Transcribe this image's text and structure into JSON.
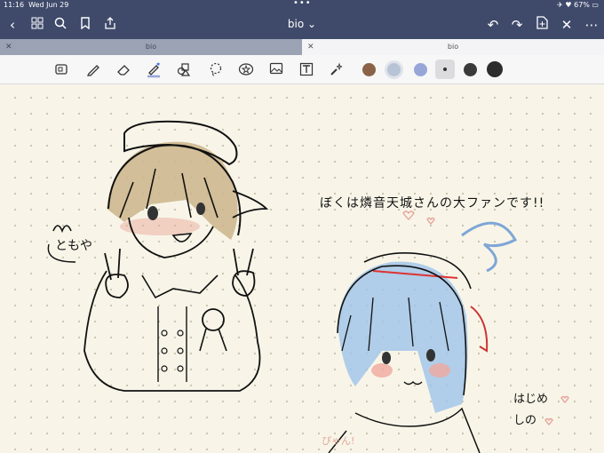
{
  "status": {
    "time": "11:16",
    "date": "Wed Jun 29",
    "battery": "67%"
  },
  "document": {
    "title": "bio",
    "dropdown_glyph": "⌄"
  },
  "tabs": [
    {
      "label": "bio",
      "active": false
    },
    {
      "label": "bio",
      "active": true
    }
  ],
  "nav_icons_left": [
    "back-icon",
    "grid-icon",
    "search-icon",
    "bookmark-icon",
    "share-icon"
  ],
  "nav_icons_right": [
    "undo-icon",
    "redo-icon",
    "add-page-icon",
    "close-icon",
    "more-icon"
  ],
  "tools": [
    "lasso-select-icon",
    "pen-icon",
    "eraser-icon",
    "highlighter-icon",
    "shapes-icon",
    "lasso-icon",
    "sticker-icon",
    "image-icon",
    "text-icon",
    "laser-pointer-icon"
  ],
  "colors": {
    "bar": "#3f4a6b",
    "swatch_brown": "#8b6248",
    "swatch_lightblue": "#b8c4d6",
    "swatch_blue": "#97a6d8",
    "swatch_dark1": "#3a3a3a",
    "swatch_dark2": "#2d2d2d"
  },
  "handwriting": {
    "main_text": "ぼくは燐音天城さんの大ファンです!!",
    "name_left": "ともや",
    "greeting_line1": "はじめ",
    "greeting_line2": "しの",
    "small_note": "ぴゃん!"
  }
}
